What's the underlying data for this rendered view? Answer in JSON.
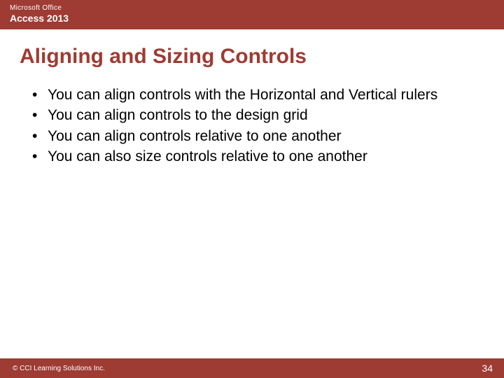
{
  "header": {
    "brand_line1": "Microsoft Office",
    "brand_line2": "Access 2013"
  },
  "title": "Aligning and Sizing Controls",
  "bullets": [
    "You can align controls with the Horizontal and Vertical rulers",
    "You can align controls to the design grid",
    "You can align controls relative to one another",
    "You can also size controls relative to one another"
  ],
  "footer": {
    "copyright": "© CCI Learning Solutions Inc.",
    "page": "34"
  }
}
